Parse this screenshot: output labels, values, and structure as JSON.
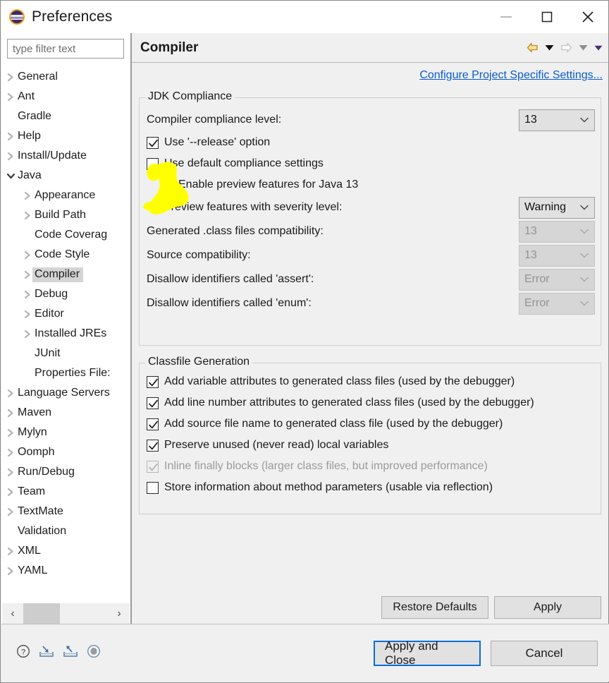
{
  "window": {
    "title": "Preferences",
    "icon": "eclipse-logo-icon",
    "minimize_label": "—",
    "maximize_label": "□",
    "close_label": "✕"
  },
  "sidebar": {
    "filter_placeholder": "type filter text",
    "filter_value": "",
    "selected": "Compiler",
    "items": [
      {
        "label": "General",
        "level": 0,
        "expandable": true,
        "expanded": false
      },
      {
        "label": "Ant",
        "level": 0,
        "expandable": true,
        "expanded": false
      },
      {
        "label": "Gradle",
        "level": 0,
        "expandable": false,
        "expanded": false
      },
      {
        "label": "Help",
        "level": 0,
        "expandable": true,
        "expanded": false
      },
      {
        "label": "Install/Update",
        "level": 0,
        "expandable": true,
        "expanded": false
      },
      {
        "label": "Java",
        "level": 0,
        "expandable": true,
        "expanded": true
      },
      {
        "label": "Appearance",
        "level": 1,
        "expandable": true,
        "expanded": false
      },
      {
        "label": "Build Path",
        "level": 1,
        "expandable": true,
        "expanded": false
      },
      {
        "label": "Code Coverag",
        "level": 1,
        "expandable": false,
        "expanded": false
      },
      {
        "label": "Code Style",
        "level": 1,
        "expandable": true,
        "expanded": false
      },
      {
        "label": "Compiler",
        "level": 1,
        "expandable": true,
        "expanded": false
      },
      {
        "label": "Debug",
        "level": 1,
        "expandable": true,
        "expanded": false
      },
      {
        "label": "Editor",
        "level": 1,
        "expandable": true,
        "expanded": false
      },
      {
        "label": "Installed JREs",
        "level": 1,
        "expandable": true,
        "expanded": false
      },
      {
        "label": "JUnit",
        "level": 1,
        "expandable": false,
        "expanded": false
      },
      {
        "label": "Properties File:",
        "level": 1,
        "expandable": false,
        "expanded": false
      },
      {
        "label": "Language Servers",
        "level": 0,
        "expandable": true,
        "expanded": false
      },
      {
        "label": "Maven",
        "level": 0,
        "expandable": true,
        "expanded": false
      },
      {
        "label": "Mylyn",
        "level": 0,
        "expandable": true,
        "expanded": false
      },
      {
        "label": "Oomph",
        "level": 0,
        "expandable": true,
        "expanded": false
      },
      {
        "label": "Run/Debug",
        "level": 0,
        "expandable": true,
        "expanded": false
      },
      {
        "label": "Team",
        "level": 0,
        "expandable": true,
        "expanded": false
      },
      {
        "label": "TextMate",
        "level": 0,
        "expandable": true,
        "expanded": false
      },
      {
        "label": "Validation",
        "level": 0,
        "expandable": false,
        "expanded": false
      },
      {
        "label": "XML",
        "level": 0,
        "expandable": true,
        "expanded": false
      },
      {
        "label": "YAML",
        "level": 0,
        "expandable": true,
        "expanded": false
      }
    ],
    "scroll_left_label": "‹",
    "scroll_right_label": "›"
  },
  "page": {
    "title": "Compiler",
    "config_link": "Configure Project Specific Settings...",
    "nav": {
      "back_icon": "back-arrow-icon",
      "back_menu_icon": "chevron-down-icon",
      "forward_icon": "forward-arrow-icon",
      "forward_menu_icon": "chevron-down-icon",
      "view_menu_icon": "chevron-down-icon"
    }
  },
  "jdk_compliance": {
    "group_label": "JDK Compliance",
    "rows": [
      {
        "label": "Compiler compliance level:",
        "value": "13",
        "enabled": true
      },
      {
        "label": "Preview features with severity level:",
        "value": "Warning",
        "enabled": true
      },
      {
        "label": "Generated .class files compatibility:",
        "value": "13",
        "enabled": false
      },
      {
        "label": "Source compatibility:",
        "value": "13",
        "enabled": false
      },
      {
        "label": "Disallow identifiers called 'assert':",
        "value": "Error",
        "enabled": false
      },
      {
        "label": "Disallow identifiers called 'enum':",
        "value": "Error",
        "enabled": false
      }
    ],
    "checkboxes": [
      {
        "label": "Use '--release' option",
        "checked": true,
        "enabled": true,
        "indent": 0
      },
      {
        "label": "Use default compliance settings",
        "checked": false,
        "enabled": true,
        "indent": 0
      },
      {
        "label": "Enable preview features for Java 13",
        "checked": true,
        "enabled": true,
        "indent": 1
      }
    ]
  },
  "classfile_generation": {
    "group_label": "Classfile Generation",
    "checkboxes": [
      {
        "label": "Add variable attributes to generated class files (used by the debugger)",
        "checked": true,
        "enabled": true
      },
      {
        "label": "Add line number attributes to generated class files (used by the debugger)",
        "checked": true,
        "enabled": true
      },
      {
        "label": "Add source file name to generated class file (used by the debugger)",
        "checked": true,
        "enabled": true
      },
      {
        "label": "Preserve unused (never read) local variables",
        "checked": true,
        "enabled": true
      },
      {
        "label": "Inline finally blocks (larger class files, but improved performance)",
        "checked": true,
        "enabled": false
      },
      {
        "label": "Store information about method parameters (usable via reflection)",
        "checked": false,
        "enabled": true
      }
    ]
  },
  "page_buttons": {
    "restore_defaults": "Restore Defaults",
    "apply": "Apply"
  },
  "footer": {
    "icons": [
      {
        "name": "help-icon"
      },
      {
        "name": "import-icon"
      },
      {
        "name": "export-icon"
      },
      {
        "name": "oomph-record-icon"
      }
    ],
    "apply_and_close": "Apply and Close",
    "cancel": "Cancel",
    "default_button": "Apply and Close"
  },
  "annotation": {
    "type": "highlighter-blob",
    "color": "#ffff00",
    "targets": [
      "Use default compliance settings",
      "Enable preview features for Java 13"
    ]
  },
  "colors": {
    "window_bg": "#f0f0f0",
    "panel_bg": "#ffffff",
    "link": "#0a5ccb",
    "focus_border": "#0a6fd4",
    "selection": "#d4d4d4",
    "highlighter": "#ffff00",
    "disabled_text": "#939393"
  }
}
